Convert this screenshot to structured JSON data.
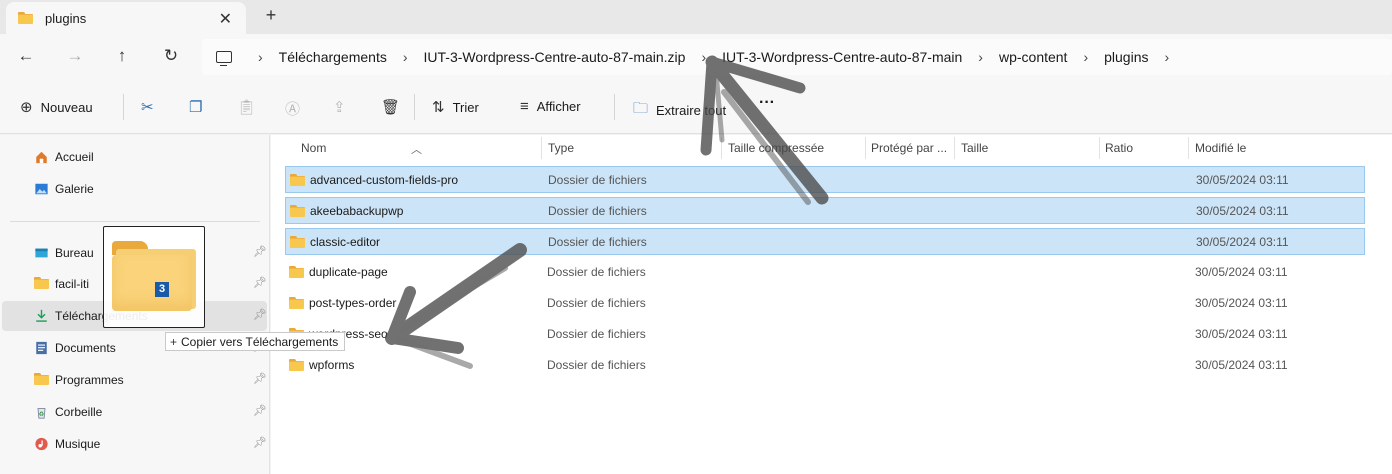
{
  "tab": {
    "title": "plugins",
    "close": "✕",
    "new": "+"
  },
  "nav": {
    "back": "←",
    "forward": "→",
    "up": "↑",
    "refresh": "↻"
  },
  "breadcrumbs": [
    "Téléchargements",
    "IUT-3-Wordpress-Centre-auto-87-main.zip",
    "IUT-3-Wordpress-Centre-auto-87-main",
    "wp-content",
    "plugins"
  ],
  "toolbar": {
    "new_label": "Nouveau",
    "sort_label": "Trier",
    "view_label": "Afficher",
    "extract_label": "Extraire tout",
    "more_label": "···"
  },
  "sidebar": {
    "items": [
      {
        "label": "Accueil",
        "icon": "home-icon"
      },
      {
        "label": "Galerie",
        "icon": "gallery-icon"
      },
      {
        "label": "Bureau",
        "icon": "desktop-icon"
      },
      {
        "label": "facil-iti",
        "icon": "folder-icon"
      },
      {
        "label": "Téléchargements",
        "icon": "download-icon"
      },
      {
        "label": "Documents",
        "icon": "documents-icon"
      },
      {
        "label": "Programmes",
        "icon": "folder-icon"
      },
      {
        "label": "Corbeille",
        "icon": "recycle-bin-icon"
      },
      {
        "label": "Musique",
        "icon": "music-icon"
      }
    ]
  },
  "columns": {
    "name": "Nom",
    "type": "Type",
    "compressed": "Taille compressée",
    "protected": "Protégé par ...",
    "size": "Taille",
    "ratio": "Ratio",
    "modified": "Modifié le"
  },
  "files": [
    {
      "name": "advanced-custom-fields-pro",
      "type": "Dossier de fichiers",
      "date": "30/05/2024 03:11",
      "selected": true
    },
    {
      "name": "akeebabackupwp",
      "type": "Dossier de fichiers",
      "date": "30/05/2024 03:11",
      "selected": true
    },
    {
      "name": "classic-editor",
      "type": "Dossier de fichiers",
      "date": "30/05/2024 03:11",
      "selected": true
    },
    {
      "name": "duplicate-page",
      "type": "Dossier de fichiers",
      "date": "30/05/2024 03:11",
      "selected": false
    },
    {
      "name": "post-types-order",
      "type": "Dossier de fichiers",
      "date": "30/05/2024 03:11",
      "selected": false
    },
    {
      "name": "wordpress-seo",
      "type": "Dossier de fichiers",
      "date": "30/05/2024 03:11",
      "selected": false
    },
    {
      "name": "wpforms",
      "type": "Dossier de fichiers",
      "date": "30/05/2024 03:11",
      "selected": false
    }
  ],
  "drag": {
    "count": "3",
    "tooltip": "Copier vers Téléchargements",
    "plus": "+"
  },
  "colors": {
    "selection": "#cce4f7",
    "selection_border": "#99c9ef",
    "folder": "#f8c84e",
    "annotation_arrow": "#5a5a5a"
  }
}
